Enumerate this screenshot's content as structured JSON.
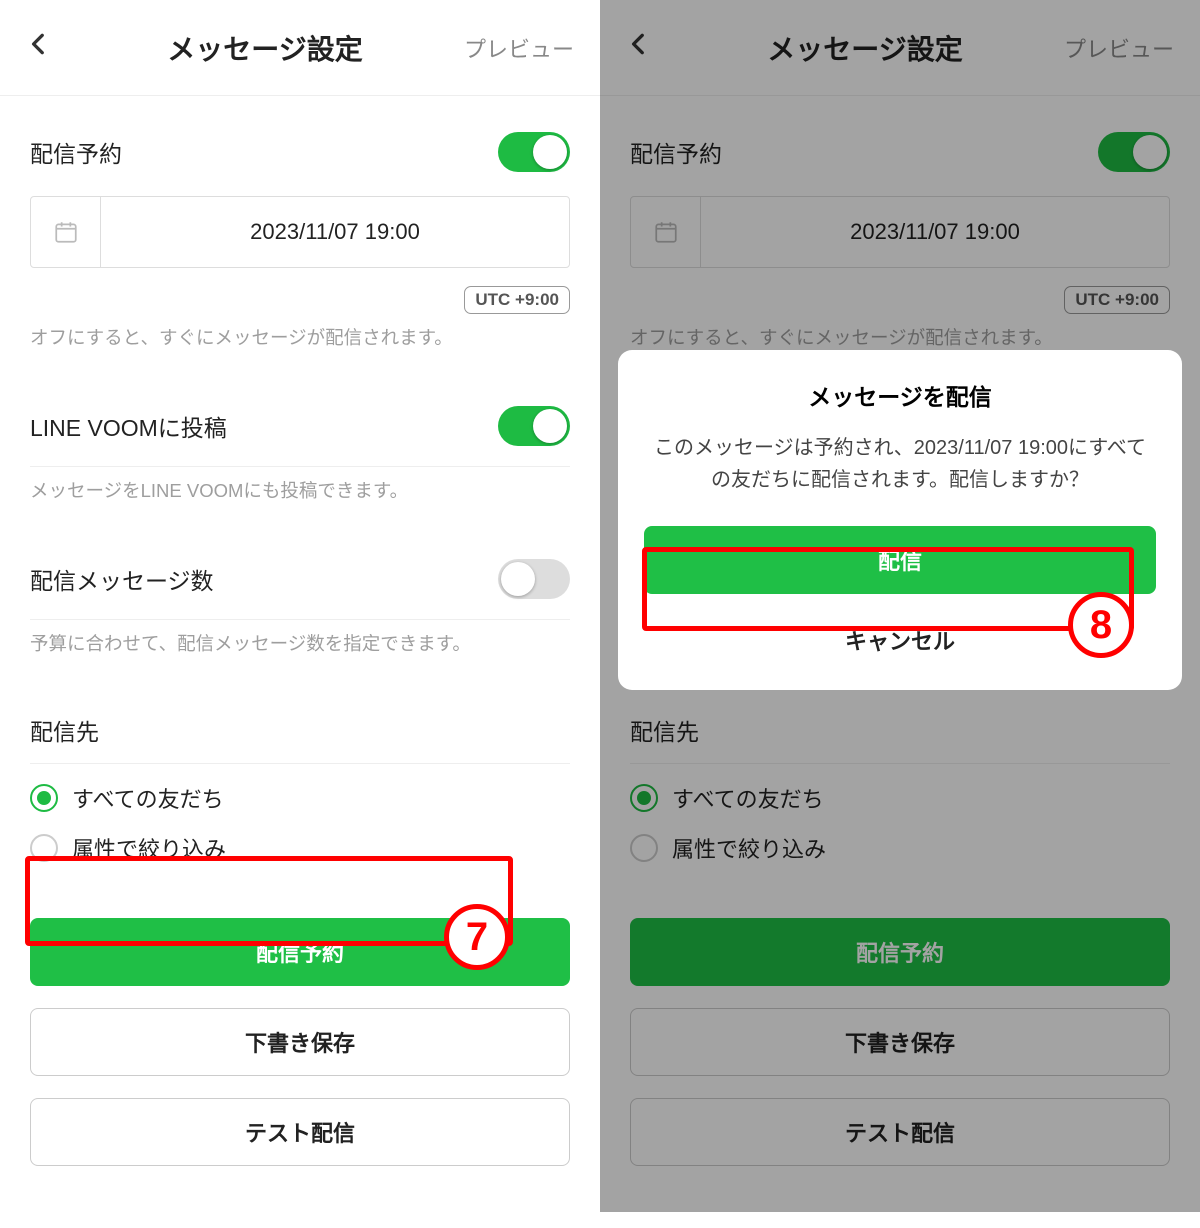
{
  "header": {
    "title": "メッセージ設定",
    "preview": "プレビュー"
  },
  "schedule": {
    "label": "配信予約",
    "datetime": "2023/11/07 19:00",
    "tz": "UTC +9:00",
    "hint": "オフにすると、すぐにメッセージが配信されます。"
  },
  "voom": {
    "label": "LINE VOOMに投稿",
    "hint": "メッセージをLINE VOOMにも投稿できます。"
  },
  "count": {
    "label": "配信メッセージ数",
    "hint": "予算に合わせて、配信メッセージ数を指定できます。"
  },
  "target": {
    "label": "配信先",
    "opt_all": "すべての友だち",
    "opt_attr": "属性で絞り込み"
  },
  "buttons": {
    "schedule": "配信予約",
    "draft": "下書き保存",
    "test": "テスト配信"
  },
  "modal": {
    "title": "メッセージを配信",
    "body": "このメッセージは予約され、2023/11/07 19:00にすべての友だちに配信されます。配信しますか？",
    "confirm": "配信",
    "cancel": "キャンセル"
  },
  "callouts": {
    "seven": "7",
    "eight": "8"
  }
}
